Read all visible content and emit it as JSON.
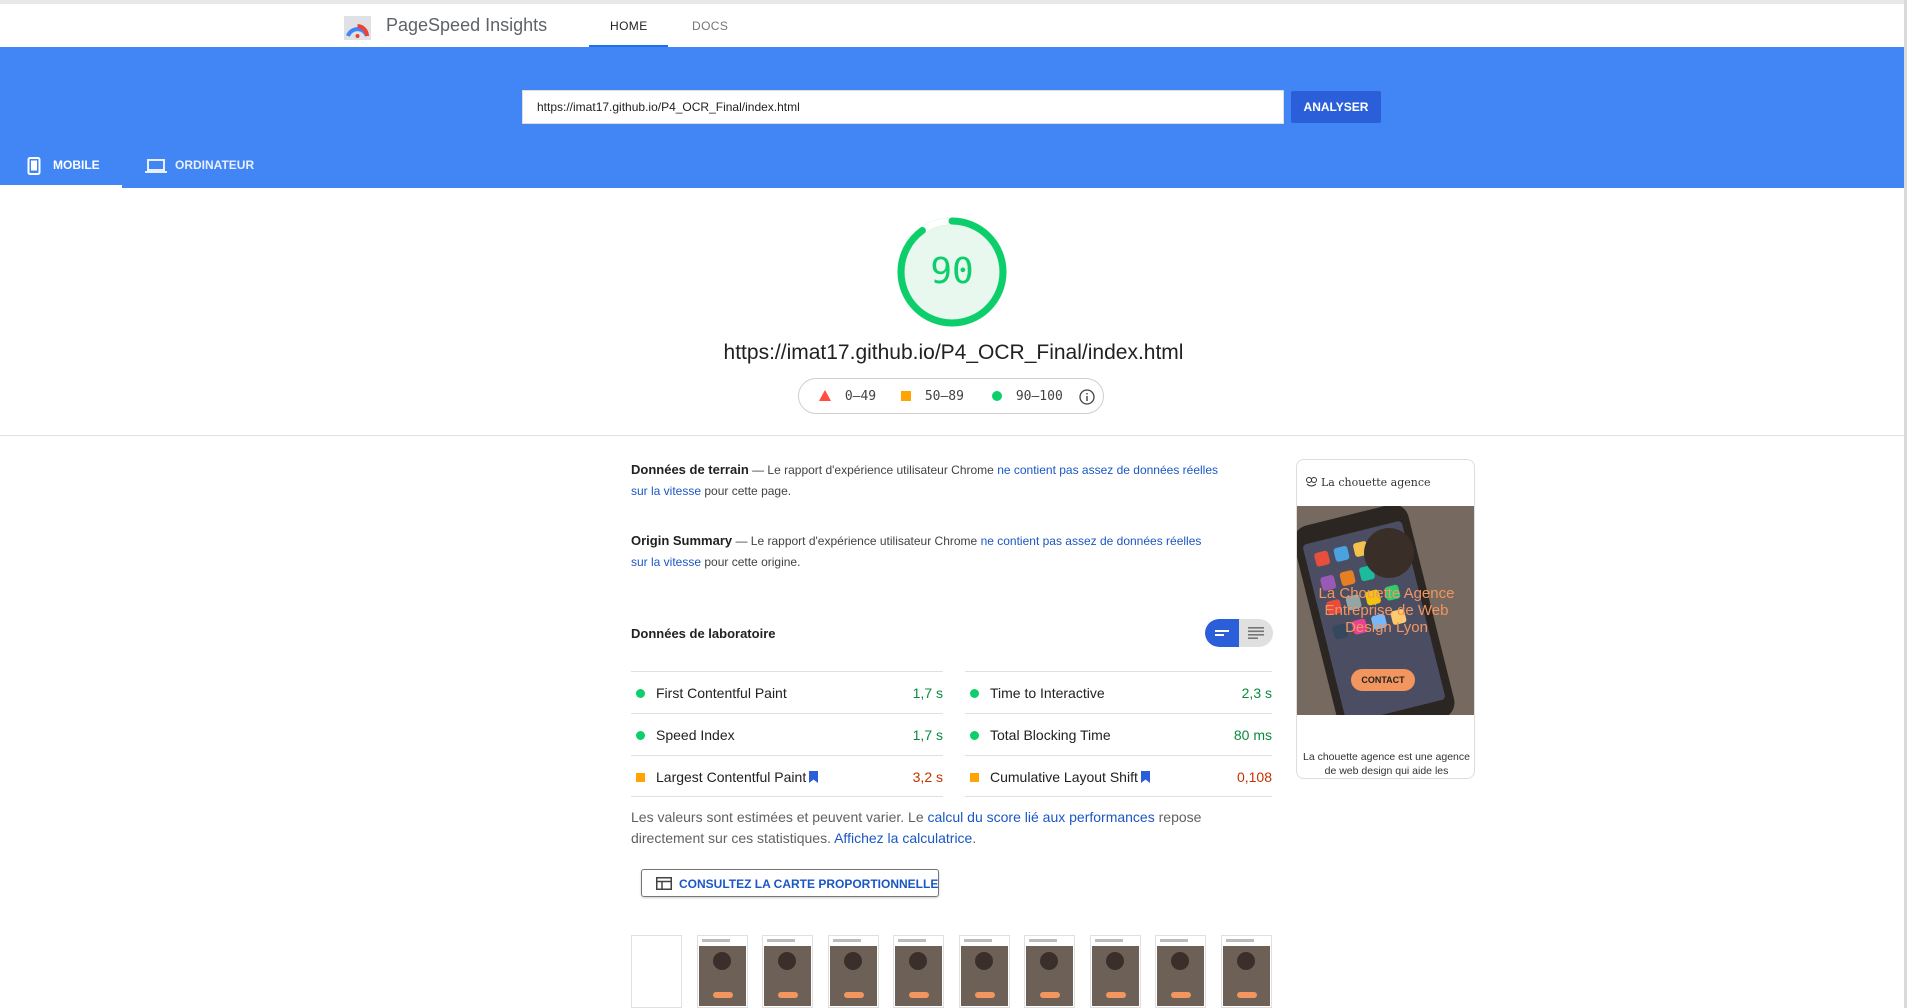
{
  "app": {
    "title": "PageSpeed Insights",
    "logo_icon": "pagespeed-gauge-icon"
  },
  "nav": {
    "tabs": [
      {
        "label": "HOME",
        "active": true
      },
      {
        "label": "DOCS",
        "active": false
      }
    ]
  },
  "search": {
    "value": "https://imat17.github.io/P4_OCR_Final/index.html",
    "button_label": "ANALYSER"
  },
  "device_tabs": [
    {
      "label": "MOBILE",
      "icon": "smartphone-icon",
      "active": true
    },
    {
      "label": "ORDINATEUR",
      "icon": "laptop-icon",
      "active": false
    }
  ],
  "score": {
    "value": 90,
    "max": 100,
    "color": "#0cce6b"
  },
  "report_url": "https://imat17.github.io/P4_OCR_Final/index.html",
  "legend": [
    {
      "range": "0–49",
      "icon": "red-triangle-icon",
      "color": "#ff4e42"
    },
    {
      "range": "50–89",
      "icon": "orange-square-icon",
      "color": "#ffa400"
    },
    {
      "range": "90–100",
      "icon": "green-circle-icon",
      "color": "#0cce6b"
    }
  ],
  "field_data": {
    "title": "Données de terrain",
    "text_before": " — Le rapport d'expérience utilisateur Chrome ",
    "link": "ne contient pas assez de données réelles sur la vitesse",
    "text_after": " pour cette page."
  },
  "origin_summary": {
    "title": "Origin Summary",
    "text_before": " — Le rapport d'expérience utilisateur Chrome ",
    "link": "ne contient pas assez de données réelles sur la vitesse",
    "text_after": " pour cette origine."
  },
  "lab": {
    "title": "Données de laboratoire",
    "metrics_left": [
      {
        "name": "First Contentful Paint",
        "value": "1,7 s",
        "status": "good",
        "bookmark": false
      },
      {
        "name": "Speed Index",
        "value": "1,7 s",
        "status": "good",
        "bookmark": false
      },
      {
        "name": "Largest Contentful Paint",
        "value": "3,2 s",
        "status": "average",
        "bookmark": true
      }
    ],
    "metrics_right": [
      {
        "name": "Time to Interactive",
        "value": "2,3 s",
        "status": "good",
        "bookmark": false
      },
      {
        "name": "Total Blocking Time",
        "value": "80 ms",
        "status": "good",
        "bookmark": false
      },
      {
        "name": "Cumulative Layout Shift",
        "value": "0,108",
        "status": "average",
        "bookmark": true
      }
    ]
  },
  "note": {
    "text1": "Les valeurs sont estimées et peuvent varier. Le ",
    "link1": "calcul du score lié aux performances",
    "text2": " repose directement sur ces statistiques. ",
    "link2": "Affichez la calculatrice",
    "text3": "."
  },
  "treemap_button": {
    "label": "CONSULTEZ LA CARTE PROPORTIONNELLE",
    "icon": "treemap-icon"
  },
  "preview": {
    "brand": "La chouette agence",
    "hero_title": "La Chouette Agence Entreprise de Web Design Lyon",
    "button": "CONTACT",
    "description": "La chouette agence est une agence de web design qui aide les"
  }
}
